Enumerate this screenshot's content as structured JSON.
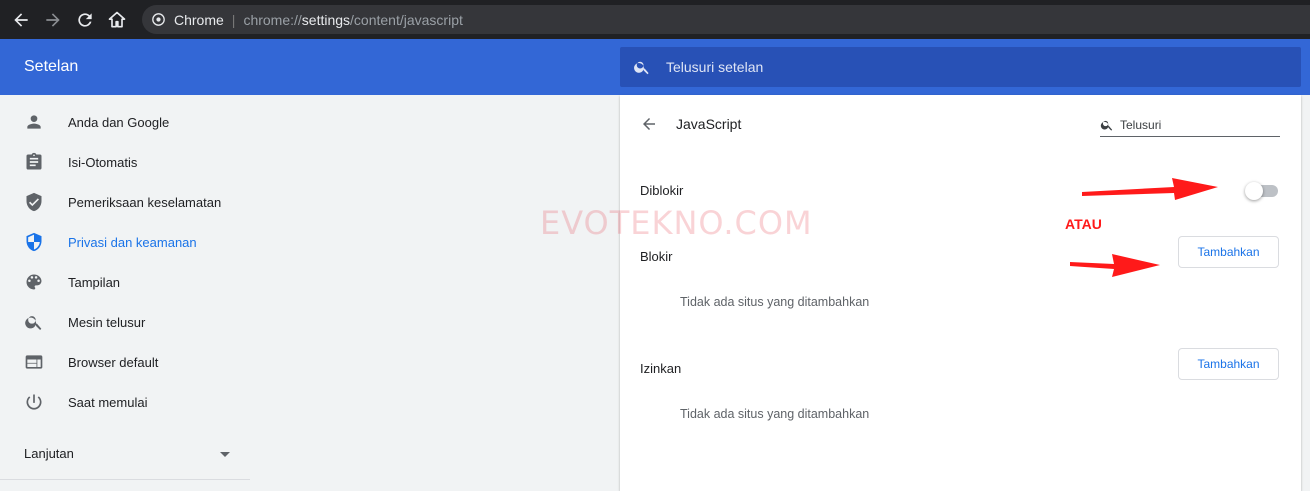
{
  "browser": {
    "site_name": "Chrome",
    "url_prefix": "chrome://",
    "url_host": "settings",
    "url_path": "/content/javascript"
  },
  "header": {
    "title": "Setelan",
    "search_placeholder": "Telusuri setelan"
  },
  "sidebar": {
    "items": [
      {
        "label": "Anda dan Google",
        "icon": "person-icon"
      },
      {
        "label": "Isi-Otomatis",
        "icon": "clipboard-icon"
      },
      {
        "label": "Pemeriksaan keselamatan",
        "icon": "shield-check-icon"
      },
      {
        "label": "Privasi dan keamanan",
        "icon": "shield-half-icon",
        "active": true
      },
      {
        "label": "Tampilan",
        "icon": "palette-icon"
      },
      {
        "label": "Mesin telusur",
        "icon": "search-icon"
      },
      {
        "label": "Browser default",
        "icon": "browser-window-icon"
      },
      {
        "label": "Saat memulai",
        "icon": "power-icon"
      }
    ],
    "advanced_label": "Lanjutan"
  },
  "main": {
    "title": "JavaScript",
    "search_placeholder": "Telusuri",
    "blocked_label": "Diblokir",
    "blocked_toggle_on": false,
    "block_section": {
      "label": "Blokir",
      "add_button": "Tambahkan",
      "empty_text": "Tidak ada situs yang ditambahkan"
    },
    "allow_section": {
      "label": "Izinkan",
      "add_button": "Tambahkan",
      "empty_text": "Tidak ada situs yang ditambahkan"
    }
  },
  "overlay": {
    "watermark": "EVOTEKNO.COM",
    "atau": "ATAU"
  },
  "colors": {
    "header_blue": "#3367d6",
    "search_blue": "#2851b6",
    "link_blue": "#1a73e8",
    "annotation_red": "#ff1a1a"
  }
}
